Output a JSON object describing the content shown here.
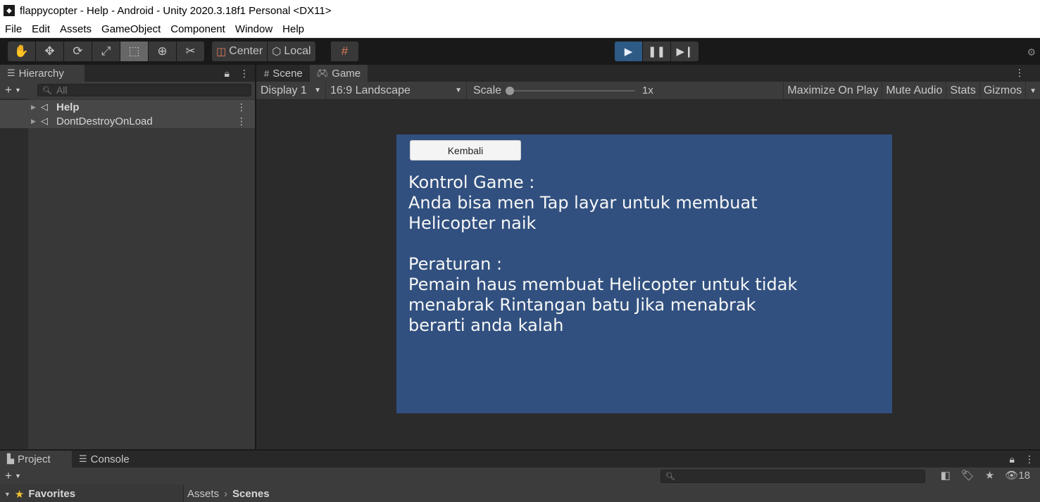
{
  "window": {
    "title": "flappycopter - Help - Android - Unity 2020.3.18f1 Personal <DX11>"
  },
  "menu": [
    "File",
    "Edit",
    "Assets",
    "GameObject",
    "Component",
    "Window",
    "Help"
  ],
  "toolbar": {
    "tools": [
      "hand-tool",
      "move-tool",
      "rotate-tool",
      "scale-tool",
      "rect-tool",
      "transform-tool",
      "custom-tool"
    ],
    "active_tool": "rect-tool",
    "pivot_label": "Center",
    "space_label": "Local",
    "play_state": "playing"
  },
  "hierarchy": {
    "tab_label": "Hierarchy",
    "search_placeholder": "All",
    "rows": [
      {
        "label": "Help",
        "bold": true
      },
      {
        "label": "DontDestroyOnLoad",
        "bold": false
      }
    ]
  },
  "game_panel": {
    "tabs": [
      {
        "label": "Scene",
        "selected": false
      },
      {
        "label": "Game",
        "selected": true
      }
    ],
    "display": "Display 1",
    "aspect": "16:9 Landscape",
    "scale_label": "Scale",
    "scale_value": "1x",
    "maximize_on_play": "Maximize On Play",
    "mute_audio": "Mute Audio",
    "stats": "Stats",
    "gizmos": "Gizmos",
    "canvas": {
      "back_button": "Kembali",
      "text": "Kontrol Game :\nAnda bisa men Tap layar untuk membuat\nHelicopter naik\n\nPeraturan :\nPemain haus membuat Helicopter untuk tidak\nmenabrak Rintangan batu Jika menabrak\nberarti anda kalah",
      "background_color": "#31507f"
    }
  },
  "bottom": {
    "tabs": [
      {
        "label": "Project",
        "selected": true
      },
      {
        "label": "Console",
        "selected": false
      }
    ],
    "hidden_count": "18",
    "favorites_label": "Favorites",
    "breadcrumb": [
      "Assets",
      "Scenes"
    ]
  }
}
